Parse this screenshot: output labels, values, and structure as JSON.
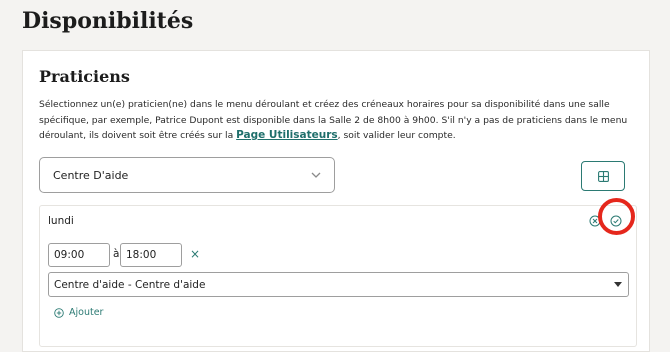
{
  "page": {
    "title": "Disponibilités"
  },
  "section": {
    "title": "Praticiens",
    "description_part1": "Sélectionnez un(e) praticien(ne) dans le menu déroulant et créez des créneaux horaires pour sa disponibilité dans une salle spécifique, par exemple, Patrice Dupont est disponible dans la Salle 2 de 8h00 à 9h00. S'il n'y a pas de praticiens dans le menu déroulant, ils doivent soit être créés sur la ",
    "description_link": "Page Utilisateurs",
    "description_part2": ", soit valider leur compte."
  },
  "practitioner_select": {
    "value": "Centre D'aide"
  },
  "grid_button": {
    "icon": "grid-icon"
  },
  "day": {
    "label": "lundi",
    "start_time": "09:00",
    "separator": "à",
    "end_time": "18:00",
    "remove_symbol": "×",
    "room_value": "Centre d'aide - Centre d'aide",
    "add_label": "Ajouter"
  },
  "colors": {
    "accent": "#2b7a73",
    "highlight": "#e5271c"
  }
}
